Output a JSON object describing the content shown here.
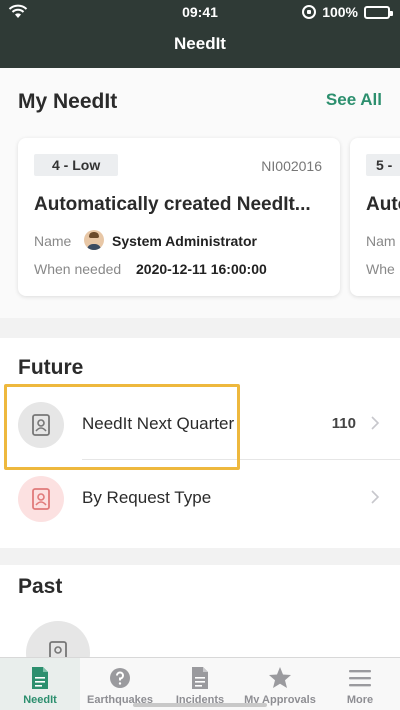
{
  "status": {
    "time": "09:41",
    "battery": "100%"
  },
  "nav": {
    "title": "NeedIt"
  },
  "my_needit": {
    "title": "My NeedIt",
    "see_all": "See All",
    "cards": [
      {
        "priority": "4 - Low",
        "number": "NI002016",
        "title": "Automatically created NeedIt...",
        "name_label": "Name",
        "name_value": "System Administrator",
        "when_label": "When needed",
        "when_value": "2020-12-11 16:00:00"
      },
      {
        "priority": "5 -",
        "title": "Auto",
        "name_label": "Nam",
        "when_label": "Whe"
      }
    ]
  },
  "future": {
    "title": "Future",
    "items": [
      {
        "label": "NeedIt Next Quarter",
        "count": "110"
      },
      {
        "label": "By Request Type"
      }
    ]
  },
  "past": {
    "title": "Past"
  },
  "tabs": [
    {
      "label": "NeedIt",
      "icon": "document-icon"
    },
    {
      "label": "Earthquakes",
      "icon": "question-icon"
    },
    {
      "label": "Incidents",
      "icon": "document-icon"
    },
    {
      "label": "My Approvals",
      "icon": "star-icon"
    },
    {
      "label": "More",
      "icon": "menu-icon"
    }
  ],
  "colors": {
    "accent": "#2c8f6e",
    "header": "#2f3a36",
    "highlight": "#eeb83d"
  }
}
